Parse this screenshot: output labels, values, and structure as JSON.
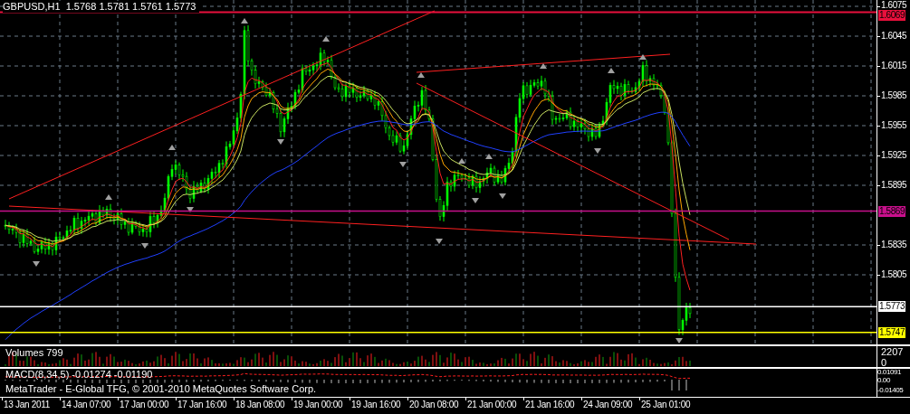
{
  "chart_header": "GBPUSD,H1  1.5768 1.5781 1.5761 1.5773",
  "y_axis_ticks": [
    "1.6075",
    "1.6045",
    "1.6015",
    "1.5985",
    "1.5955",
    "1.5925",
    "1.5895",
    "1.5835",
    "1.5805"
  ],
  "price_lines": [
    {
      "label": "1.6069",
      "color": "#e8103c"
    },
    {
      "label": "1.5869",
      "color": "#c8108c"
    },
    {
      "label": "1.5773",
      "color": "#ffffff"
    },
    {
      "label": "1.5747",
      "color": "#ffff00"
    }
  ],
  "volumes_panel": {
    "title": "Volumes 799",
    "axis": [
      "2207",
      "0"
    ]
  },
  "macd_panel": {
    "title": "MACD(8,34,5) -0.01274 -0.01190",
    "axis": [
      "0.01091",
      "0.00",
      "-0.01405"
    ]
  },
  "footer": "MetaTrader - E-Global TFG, © 2001-2010 MetaQuotes Software Corp.",
  "x_axis_labels": [
    "13 Jan 2011",
    "14 Jan 07:00",
    "17 Jan 00:00",
    "17 Jan 16:00",
    "18 Jan 08:00",
    "19 Jan 00:00",
    "19 Jan 16:00",
    "20 Jan 08:00",
    "21 Jan 00:00",
    "21 Jan 16:00",
    "24 Jan 09:00",
    "25 Jan 01:00"
  ]
}
